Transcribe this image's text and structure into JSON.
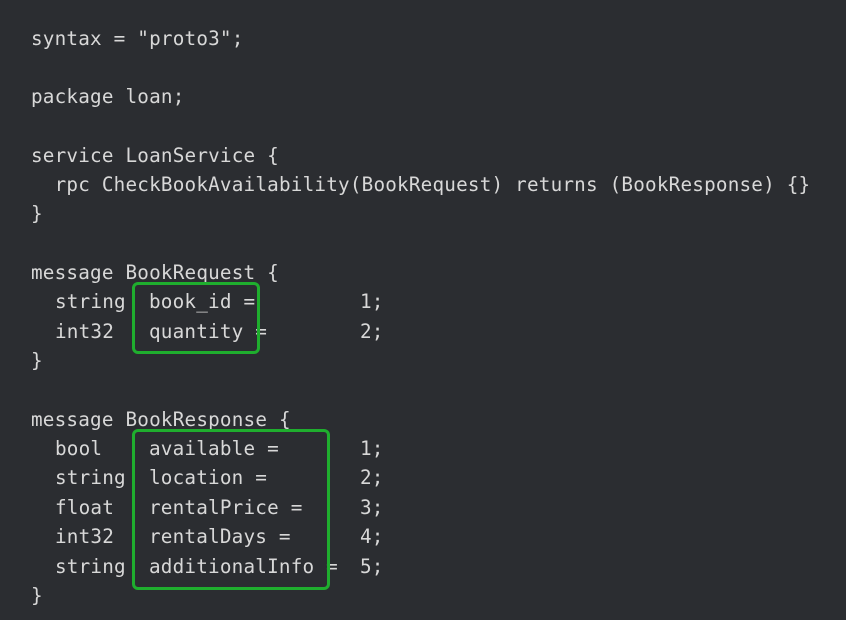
{
  "editor": {
    "lines": {
      "syntax": "syntax = \"proto3\";",
      "package": "package loan;",
      "service_open": "service LoanService {",
      "rpc": "  rpc CheckBookAvailability(BookRequest) returns (BookResponse) {}",
      "service_close": "}",
      "req_open": "message BookRequest {",
      "req_close": "}",
      "resp_open": "message BookResponse {",
      "resp_close": "}"
    },
    "request_fields": [
      {
        "type": "string",
        "name": "book_id =",
        "num": "1;"
      },
      {
        "type": "int32",
        "name": "quantity =",
        "num": "2;"
      }
    ],
    "response_fields": [
      {
        "type": "bool",
        "name": "available =",
        "num": "1;"
      },
      {
        "type": "string",
        "name": "location =",
        "num": "2;"
      },
      {
        "type": "float",
        "name": "rentalPrice =",
        "num": "3;"
      },
      {
        "type": "int32",
        "name": "rentalDays =",
        "num": "4;"
      },
      {
        "type": "string",
        "name": "additionalInfo =",
        "num": "5;"
      }
    ],
    "highlight_color": "#1fae2e"
  }
}
